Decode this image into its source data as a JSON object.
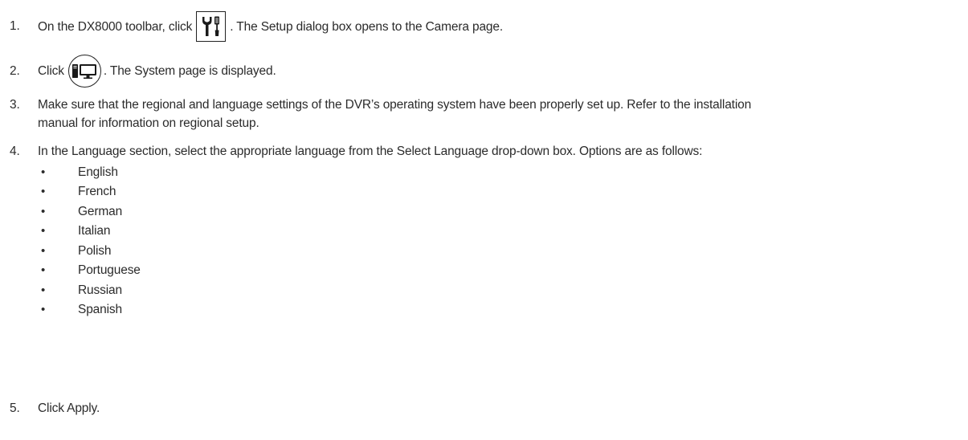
{
  "steps": {
    "s1": {
      "number": "1.",
      "before": "On the DX8000 toolbar, click",
      "icon": "setup-tools-icon",
      "after": ". The Setup dialog box opens to the Camera page."
    },
    "s2": {
      "number": "2.",
      "before": "Click",
      "icon": "system-computer-icon",
      "after": ". The System page is displayed."
    },
    "s3": {
      "number": "3.",
      "line1": "Make sure that the regional and language settings of the DVR’s operating system have been properly set up. Refer to the installation",
      "line2": "manual for information on regional setup."
    },
    "s4": {
      "number": "4.",
      "text": "In the Language section, select the appropriate language from the Select Language drop-down box. Options are as follows:",
      "bullet_symbol": "•",
      "options": [
        "English",
        "French",
        "German",
        "Italian",
        "Polish",
        "Portuguese",
        "Russian",
        "Spanish"
      ]
    },
    "s5": {
      "number": "5.",
      "text": "Click Apply."
    }
  }
}
